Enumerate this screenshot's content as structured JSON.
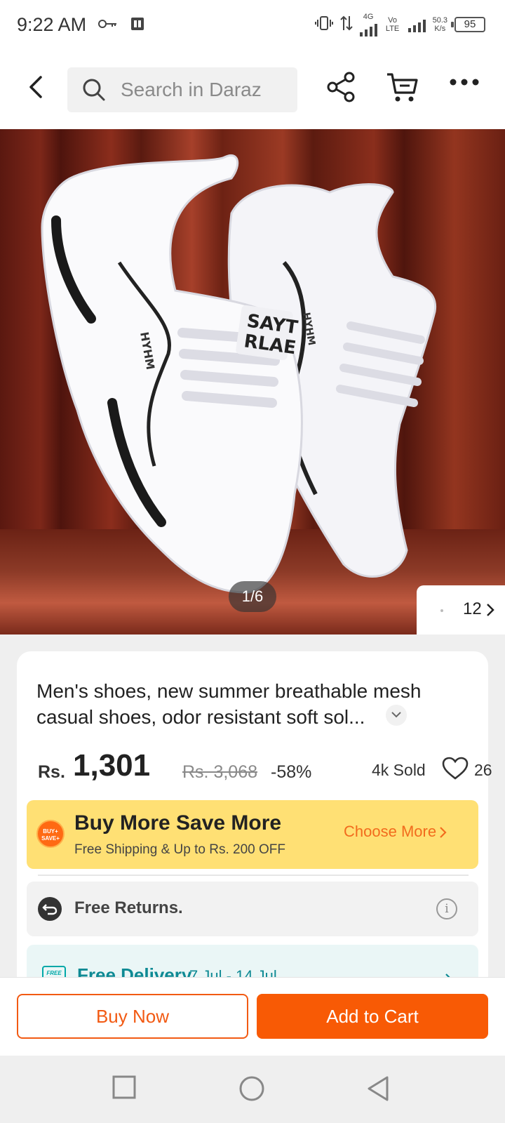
{
  "status_bar": {
    "time": "9:22 AM",
    "net_speed_value": "50.3",
    "net_speed_unit": "K/s",
    "battery": "95",
    "net_4g": "4G",
    "volte": "Vo LTE"
  },
  "top_bar": {
    "search_placeholder": "Search in Daraz"
  },
  "gallery": {
    "image_counter": "1/6",
    "thumbnail_count": "12"
  },
  "product": {
    "title": "Men's shoes, new summer breathable mesh casual shoes, odor resistant soft sol...",
    "currency": "Rs.",
    "price": "1,301",
    "original_price": "Rs. 3,068",
    "discount": "-58%",
    "sold": "4k Sold",
    "wishlist_count": "26"
  },
  "promo": {
    "badge_line1": "BUY+",
    "badge_line2": "SAVE+",
    "heading": "Buy More Save More",
    "subtext": "Free Shipping & Up to Rs. 200 OFF",
    "link": "Choose More"
  },
  "returns": {
    "label": "Free Returns."
  },
  "delivery": {
    "badge": "FREE",
    "label": "Free Delivery",
    "dates": "7 Jul - 14 Jul"
  },
  "actions": {
    "buy_now": "Buy Now",
    "add_to_cart": "Add to Cart"
  },
  "colors": {
    "accent": "#f85a05",
    "promo_bg": "#ffe074",
    "delivery_text": "#0f8a94"
  }
}
